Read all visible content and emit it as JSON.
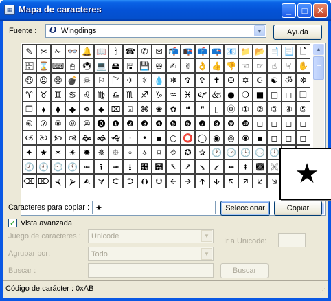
{
  "window": {
    "title": "Mapa de caracteres"
  },
  "font": {
    "label": "Fuente :",
    "value": "Wingdings",
    "icon_glyph": "O"
  },
  "buttons": {
    "help": "Ayuda",
    "select": "Seleccionar",
    "copy": "Copiar",
    "search": "Buscar"
  },
  "grid": {
    "columns": 20,
    "rows": [
      [
        "✎",
        "✂",
        "✁",
        "👓",
        "🔔",
        "📖",
        "🕯",
        "☎",
        "✆",
        "✉",
        "📬",
        "📭",
        "📫",
        "📪",
        "📧",
        "📁",
        "📂",
        "📄",
        "📃",
        "🗋"
      ],
      [
        "🗄",
        "⌛",
        "⌨",
        "🖱",
        "🖲",
        "💻",
        "🖴",
        "🖫",
        "💾",
        "✇",
        "✍",
        "✌",
        "👌",
        "👍",
        "👎",
        "☜",
        "☞",
        "☝",
        "☟",
        "✋"
      ],
      [
        "☺",
        "😐",
        "☹",
        "💣",
        "☠",
        "⚐",
        "🏱",
        "✈",
        "☼",
        "💧",
        "❄",
        "✞",
        "✞",
        "✝",
        "✠",
        "✡",
        "☪",
        "☯",
        "ॐ",
        "☸"
      ],
      [
        "♈",
        "♉",
        "♊",
        "♋",
        "♌",
        "♍",
        "♎",
        "♏",
        "♐",
        "♑",
        "♒",
        "♓",
        "🙰",
        "🙵",
        "●",
        "❍",
        "■",
        "□",
        "◻",
        "❑"
      ],
      [
        "❒",
        "⬧",
        "⧫",
        "◆",
        "❖",
        "⬥",
        "⌧",
        "⍓",
        "⌘",
        "❀",
        "✿",
        "❝",
        "❞",
        "▯",
        "⓪",
        "①",
        "②",
        "③",
        "④",
        "⑤"
      ],
      [
        "⑥",
        "⑦",
        "⑧",
        "⑨",
        "⑩",
        "⓿",
        "❶",
        "❷",
        "❸",
        "❹",
        "❺",
        "❻",
        "❼",
        "❽",
        "❾",
        "❿",
        "◻",
        "◻",
        "◻",
        "◻"
      ],
      [
        "🙢",
        "🙠",
        "🙡",
        "🙣",
        "🙞",
        "🙜",
        "🙝",
        "·",
        "•",
        "▪",
        "○",
        "⭕",
        "◯",
        "◉",
        "◎",
        "🞊",
        "▪",
        "◻",
        "◻",
        "◻"
      ],
      [
        "✦",
        "★",
        "✶",
        "✴",
        "✹",
        "✵",
        "⯐",
        "⌖",
        "⟡",
        "⌑",
        "⯑",
        "✪",
        "✰",
        "🕐",
        "🕑",
        "🕒",
        "🕓",
        "🕔",
        "🕕",
        "🕖"
      ],
      [
        "🕗",
        "🕘",
        "🕙",
        "🕚",
        "⭰",
        "⭱",
        "⭲",
        "⭳",
        "⭴",
        "⭵",
        "⭶",
        "⭷",
        "⭸",
        "⭹",
        "⭺",
        "⭻",
        "🙩",
        "🙨",
        "🙪",
        "🙫"
      ],
      [
        "⌫",
        "⌦",
        "⮘",
        "⮚",
        "⮙",
        "⮛",
        "⮈",
        "⮊",
        "⮉",
        "⮋",
        "🡨",
        "🡪",
        "🡩",
        "🡫",
        "🡬",
        "🡭",
        "🡯",
        "🡮",
        "🡸",
        "🡺"
      ]
    ]
  },
  "enlarged": {
    "glyph": "★"
  },
  "copy_field": {
    "label": "Caracteres para copiar :",
    "value": "★"
  },
  "advanced": {
    "label": "Vista avanzada",
    "checked": true
  },
  "charset": {
    "label": "Juego de caracteres :",
    "value": "Unicode"
  },
  "group_by": {
    "label": "Agrupar por:",
    "value": "Todo"
  },
  "search": {
    "label": "Buscar :",
    "value": ""
  },
  "goto_unicode": {
    "label": "Ir a Unicode:",
    "value": ""
  },
  "status": {
    "text": "Código de carácter : 0xAB"
  }
}
